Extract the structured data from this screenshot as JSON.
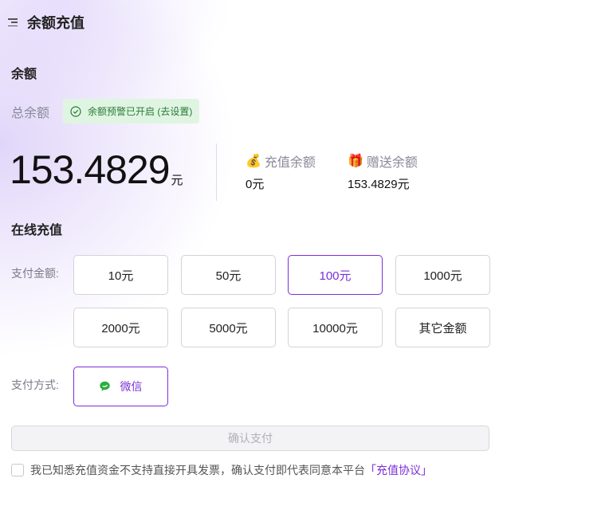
{
  "header": {
    "title": "余额充值",
    "menu_icon": "menu-collapse-icon"
  },
  "balance_section": {
    "title": "余额",
    "total_label": "总余额",
    "alert_badge": "余额预警已开启 (去设置)",
    "total_value": "153.4829",
    "unit": "元",
    "recharge": {
      "icon": "💰",
      "label": "充值余额",
      "value": "0元"
    },
    "gift": {
      "icon": "🎁",
      "label": "赠送余额",
      "value": "153.4829元"
    }
  },
  "online_recharge": {
    "title": "在线充值",
    "amount_label": "支付金额:",
    "amounts": [
      "10元",
      "50元",
      "100元",
      "1000元",
      "2000元",
      "5000元",
      "10000元",
      "其它金额"
    ],
    "selected_amount": "100元",
    "method_label": "支付方式:",
    "method": "微信",
    "confirm_label": "确认支付",
    "agreement_text": "我已知悉充值资金不支持直接开具发票，确认支付即代表同意本平台",
    "agreement_link": "「充值协议」"
  },
  "colors": {
    "accent": "#7b2fd6",
    "success_bg": "#dff5e2",
    "success_text": "#2b7a36",
    "wechat": "#2aae3e"
  }
}
